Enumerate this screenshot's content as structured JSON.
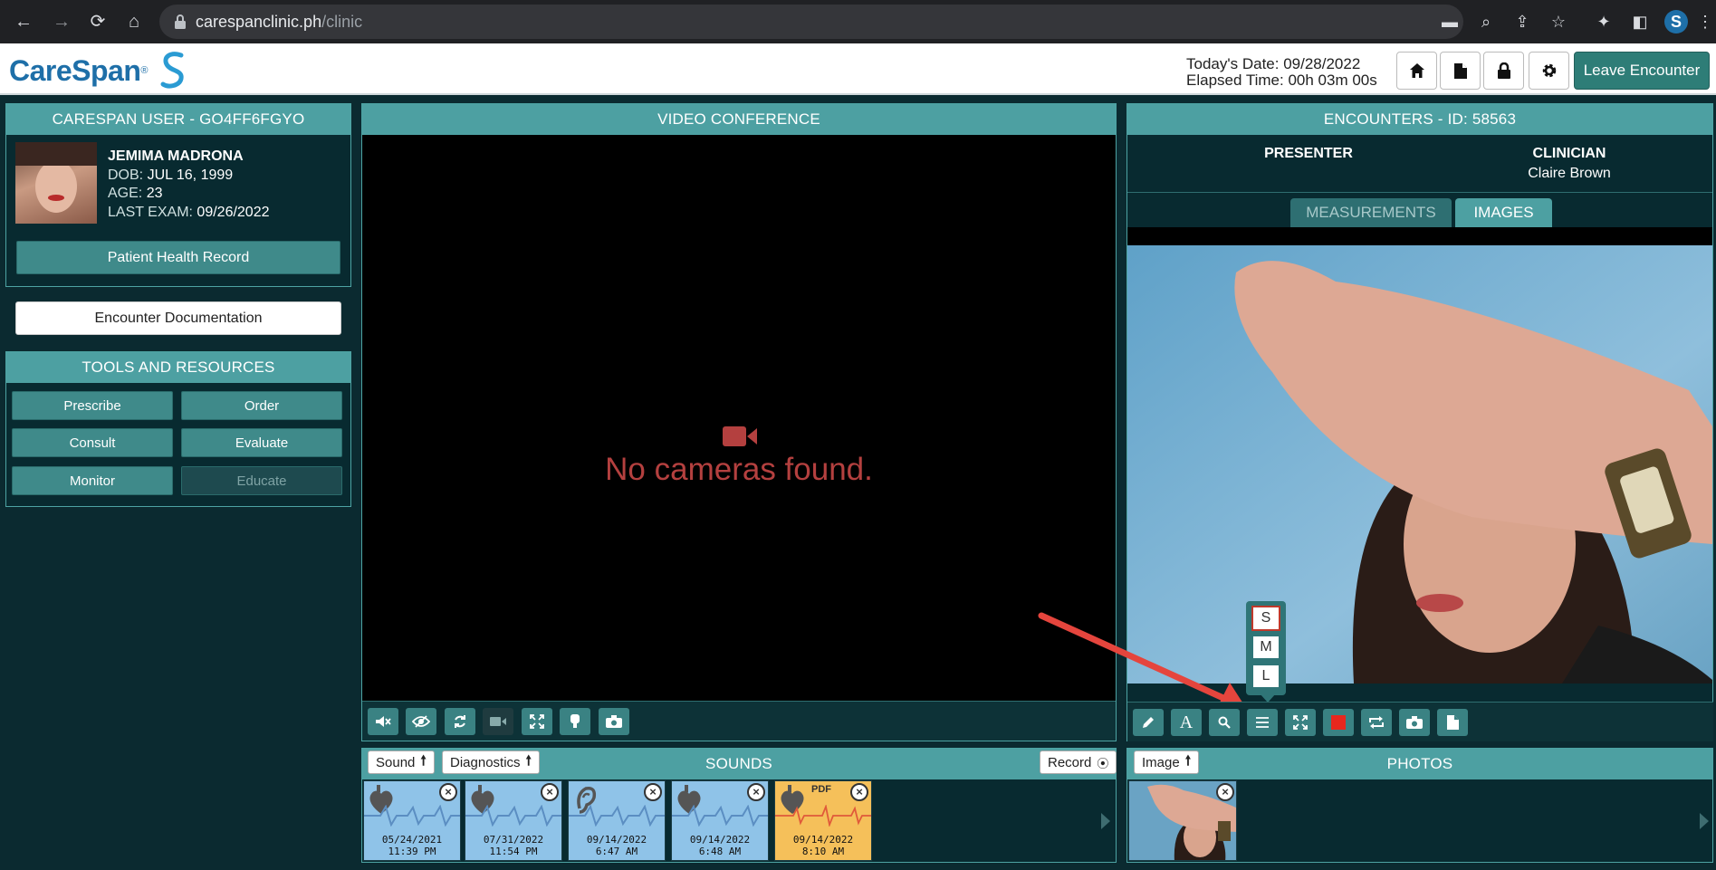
{
  "browser": {
    "url_host": "carespanclinic.ph",
    "url_path": "/clinic"
  },
  "header": {
    "logo_text": "CareSpan",
    "logo_tm": "®",
    "today_label": "Today's Date:",
    "today_value": "09/28/2022",
    "elapsed_label": "Elapsed Time:",
    "elapsed_value": "00h 03m 00s",
    "leave_label": "Leave Encounter"
  },
  "user_panel": {
    "title": "CARESPAN USER - GO4FF6FGYO",
    "name": "JEMIMA MADRONA",
    "dob_label": "DOB:",
    "dob_value": "JUL 16, 1999",
    "age_label": "AGE:",
    "age_value": "23",
    "exam_label": "LAST EXAM:",
    "exam_value": "09/26/2022",
    "phr_button": "Patient Health Record"
  },
  "encounter_doc": "Encounter Documentation",
  "tools": {
    "title": "TOOLS AND RESOURCES",
    "buttons": [
      "Prescribe",
      "Order",
      "Consult",
      "Evaluate",
      "Monitor",
      "Educate"
    ]
  },
  "video": {
    "title": "VIDEO CONFERENCE",
    "message": "No cameras found."
  },
  "encounters": {
    "title": "ENCOUNTERS - ID: 58563",
    "presenter_label": "PRESENTER",
    "clinician_label": "CLINICIAN",
    "clinician_name": "Claire Brown",
    "tabs": [
      "MEASUREMENTS",
      "IMAGES"
    ],
    "active_tab": "IMAGES",
    "size_options": [
      "S",
      "M",
      "L"
    ]
  },
  "sounds": {
    "title": "SOUNDS",
    "sound_btn": "Sound",
    "diag_btn": "Diagnostics",
    "record_btn": "Record",
    "items": [
      {
        "date": "05/24/2021",
        "time": "11:39 PM",
        "icon": "heart-icon"
      },
      {
        "date": "07/31/2022",
        "time": "11:54 PM",
        "icon": "heart-icon"
      },
      {
        "date": "09/14/2022",
        "time": "6:47 AM",
        "icon": "ear-icon"
      },
      {
        "date": "09/14/2022",
        "time": "6:48 AM",
        "icon": "heart-icon"
      },
      {
        "date": "09/14/2022",
        "time": "8:10 AM",
        "icon": "heart-icon",
        "badge": "PDF"
      }
    ]
  },
  "photos": {
    "title": "PHOTOS",
    "image_btn": "Image"
  },
  "colors": {
    "teal_header": "#4da0a2",
    "panel_bg": "#082a30",
    "alert_red": "#b4403f"
  }
}
